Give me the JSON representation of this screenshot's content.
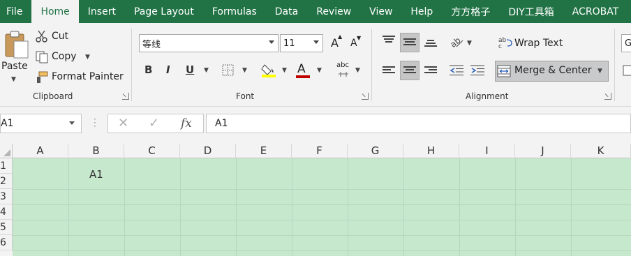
{
  "menu": {
    "tabs": [
      "File",
      "Home",
      "Insert",
      "Page Layout",
      "Formulas",
      "Data",
      "Review",
      "View",
      "Help",
      "方方格子",
      "DIY工具箱",
      "ACROBAT"
    ],
    "active": "Home"
  },
  "clipboard": {
    "paste": "Paste",
    "cut": "Cut",
    "copy": "Copy",
    "format_painter": "Format Painter",
    "label": "Clipboard"
  },
  "font": {
    "family": "等线",
    "size": "11",
    "bold": "B",
    "italic": "I",
    "underline": "U",
    "grow": "A",
    "shrink": "A",
    "font_color_glyph": "A",
    "abc": "abc",
    "label": "Font",
    "highlight_color": "#ffff00",
    "font_color": "#c00000"
  },
  "alignment": {
    "wrap_text": "Wrap Text",
    "merge_center": "Merge & Center",
    "label": "Alignment"
  },
  "number": {
    "format_partial": "G"
  },
  "formula_bar": {
    "name_box": "A1",
    "fx": "fx",
    "content": "A1"
  },
  "sheet": {
    "columns": [
      "A",
      "B",
      "C",
      "D",
      "E",
      "F",
      "G",
      "H",
      "I",
      "J",
      "K"
    ],
    "rows": [
      "1",
      "2",
      "3",
      "4",
      "5",
      "6"
    ],
    "cell_value": "A1",
    "fill_color": "#c6e8cd"
  }
}
